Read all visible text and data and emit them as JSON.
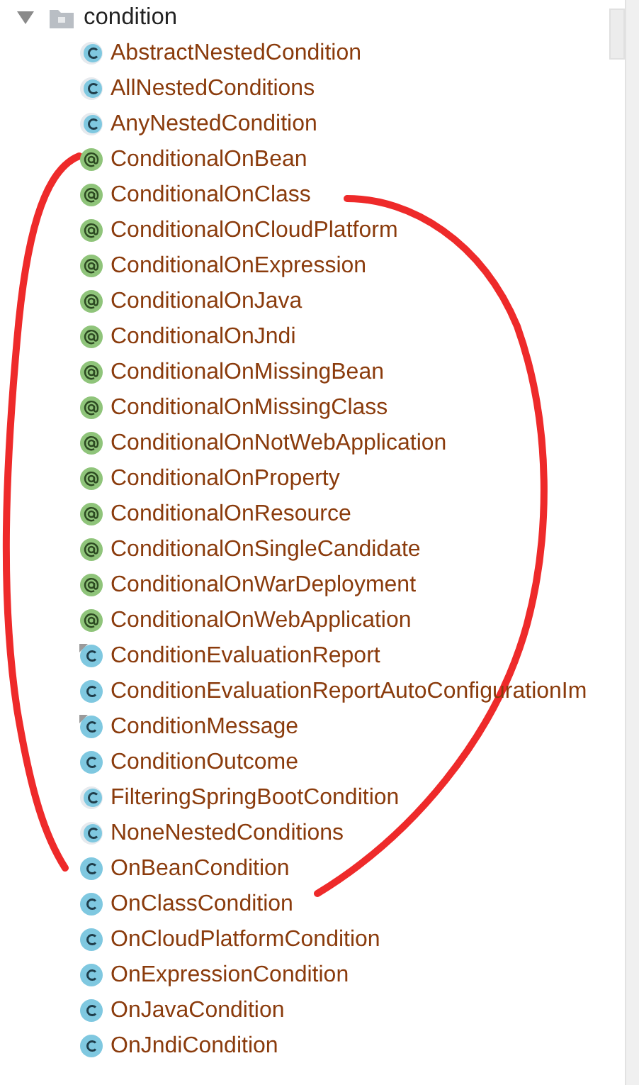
{
  "folder": {
    "name": "condition",
    "expanded": true
  },
  "items": [
    {
      "name": "AbstractNestedCondition",
      "kind": "abstract"
    },
    {
      "name": "AllNestedConditions",
      "kind": "abstract"
    },
    {
      "name": "AnyNestedCondition",
      "kind": "abstract"
    },
    {
      "name": "ConditionalOnBean",
      "kind": "annotation"
    },
    {
      "name": "ConditionalOnClass",
      "kind": "annotation"
    },
    {
      "name": "ConditionalOnCloudPlatform",
      "kind": "annotation"
    },
    {
      "name": "ConditionalOnExpression",
      "kind": "annotation"
    },
    {
      "name": "ConditionalOnJava",
      "kind": "annotation"
    },
    {
      "name": "ConditionalOnJndi",
      "kind": "annotation"
    },
    {
      "name": "ConditionalOnMissingBean",
      "kind": "annotation"
    },
    {
      "name": "ConditionalOnMissingClass",
      "kind": "annotation"
    },
    {
      "name": "ConditionalOnNotWebApplication",
      "kind": "annotation"
    },
    {
      "name": "ConditionalOnProperty",
      "kind": "annotation"
    },
    {
      "name": "ConditionalOnResource",
      "kind": "annotation"
    },
    {
      "name": "ConditionalOnSingleCandidate",
      "kind": "annotation"
    },
    {
      "name": "ConditionalOnWarDeployment",
      "kind": "annotation"
    },
    {
      "name": "ConditionalOnWebApplication",
      "kind": "annotation"
    },
    {
      "name": "ConditionEvaluationReport",
      "kind": "marked-class"
    },
    {
      "name": "ConditionEvaluationReportAutoConfigurationIm",
      "kind": "class"
    },
    {
      "name": "ConditionMessage",
      "kind": "marked-class"
    },
    {
      "name": "ConditionOutcome",
      "kind": "class"
    },
    {
      "name": "FilteringSpringBootCondition",
      "kind": "abstract"
    },
    {
      "name": "NoneNestedConditions",
      "kind": "abstract"
    },
    {
      "name": "OnBeanCondition",
      "kind": "class"
    },
    {
      "name": "OnClassCondition",
      "kind": "class"
    },
    {
      "name": "OnCloudPlatformCondition",
      "kind": "class"
    },
    {
      "name": "OnExpressionCondition",
      "kind": "class"
    },
    {
      "name": "OnJavaCondition",
      "kind": "class"
    },
    {
      "name": "OnJndiCondition",
      "kind": "class"
    }
  ]
}
